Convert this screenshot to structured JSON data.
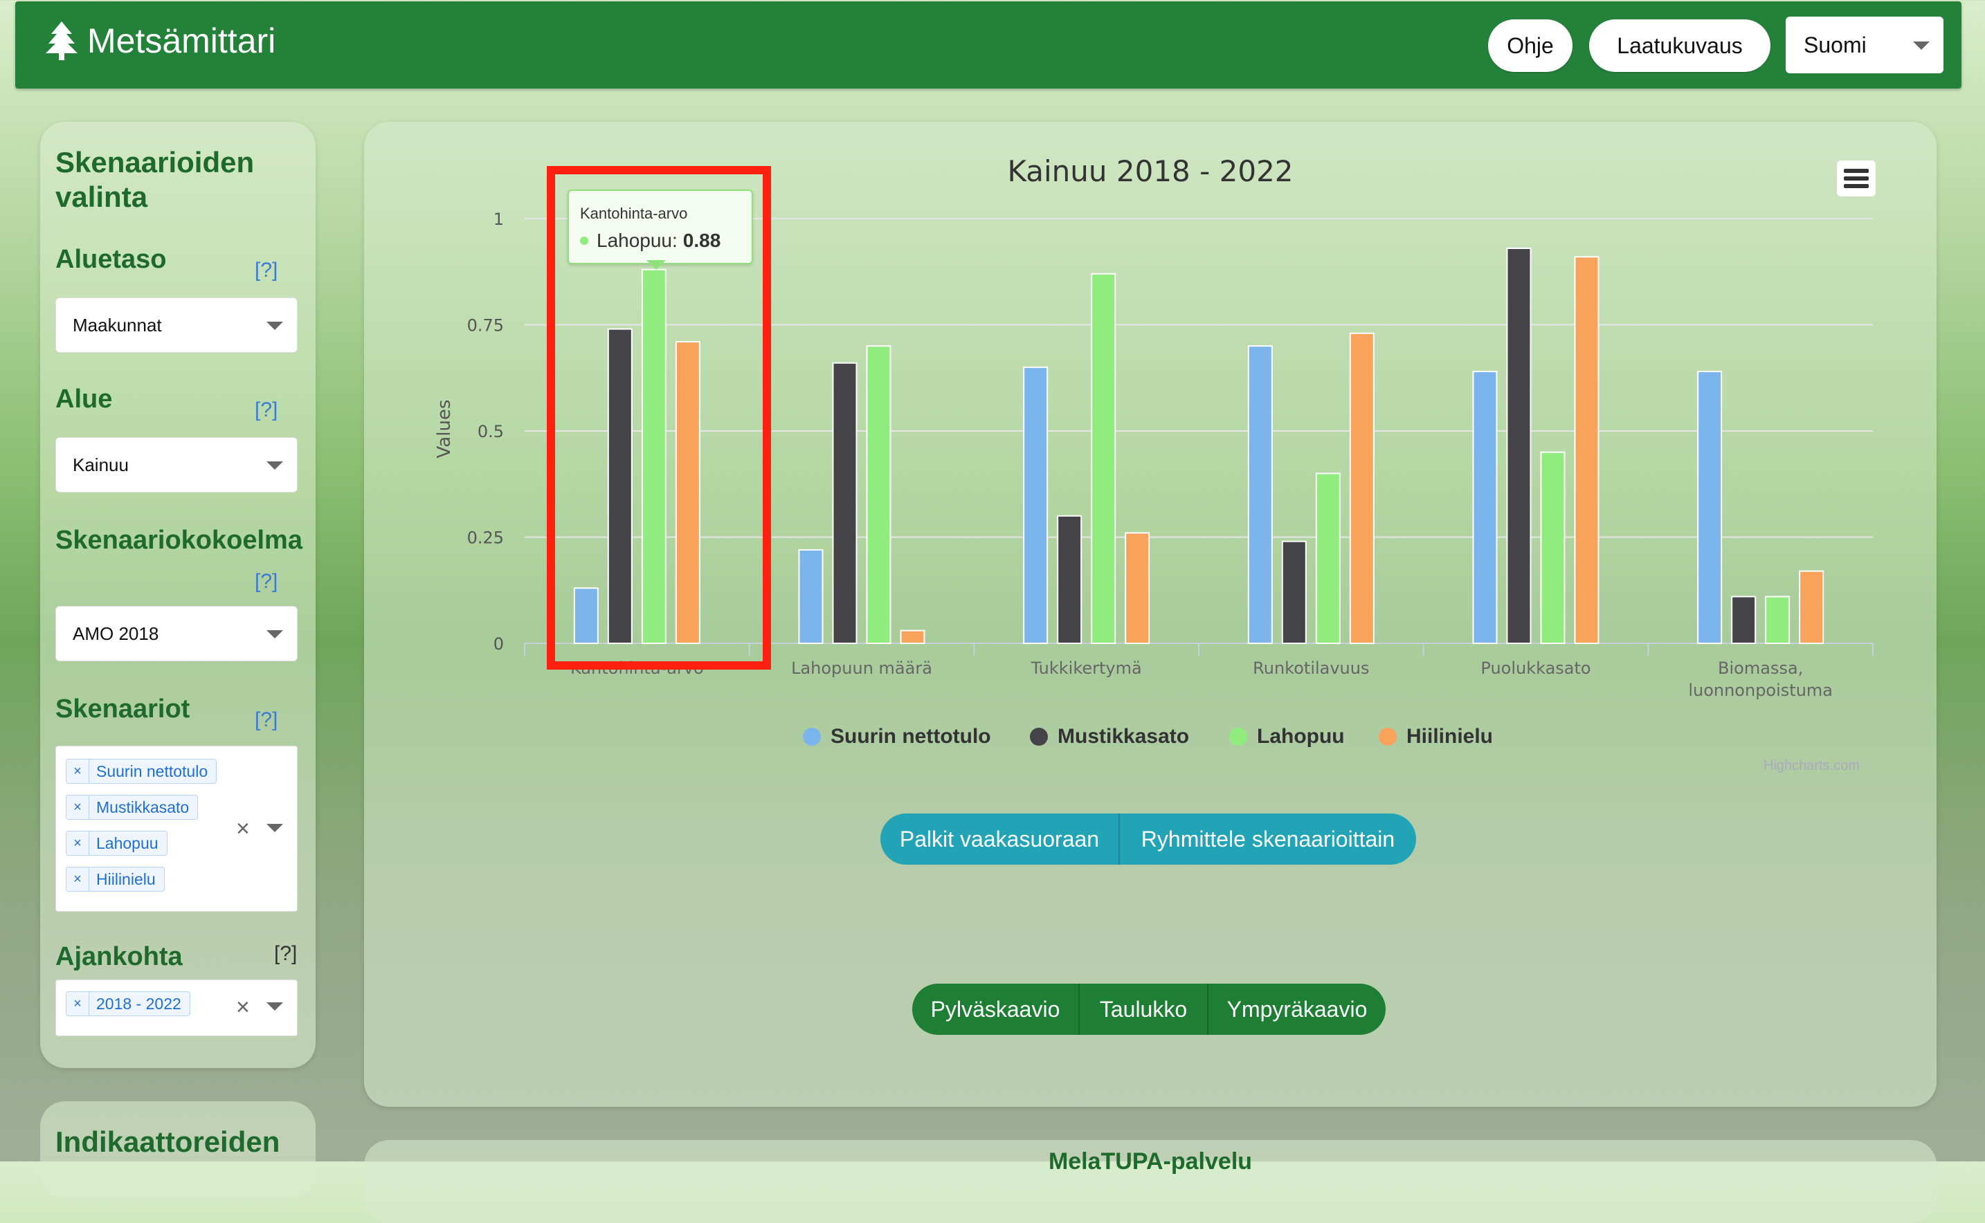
{
  "header": {
    "app_title": "Metsämittari",
    "help_label": "Ohje",
    "quality_label": "Laatukuvaus",
    "language_selected": "Suomi"
  },
  "sidebar": {
    "section_title_line1": "Skenaarioiden",
    "section_title_line2": "valinta",
    "aluetaso": {
      "label": "Aluetaso",
      "help": "[?]",
      "value": "Maakunnat"
    },
    "alue": {
      "label": "Alue",
      "help": "[?]",
      "value": "Kainuu"
    },
    "skenaariokokoelma": {
      "label": "Skenaariokokoelma",
      "help": "[?]",
      "value": "AMO 2018"
    },
    "skenaariot": {
      "label": "Skenaariot",
      "help": "[?]",
      "tags": [
        "Suurin nettotulo",
        "Mustikkasato",
        "Lahopuu",
        "Hiilinielu"
      ]
    },
    "ajankohta": {
      "label": "Ajankohta",
      "help": "[?]",
      "tags": [
        "2018 - 2022"
      ]
    },
    "next_section_title": "Indikaattoreiden"
  },
  "main": {
    "orientation_buttons": [
      "Palkit vaakasuoraan",
      "Ryhmittele skenaarioittain"
    ],
    "view_buttons": [
      "Pylväskaavio",
      "Taulukko",
      "Ympyräkaavio"
    ],
    "credits": "Highcharts.com",
    "next_panel_title": "MelaTUPA-palvelu"
  },
  "tooltip": {
    "title": "Kantohinta-arvo",
    "series": "Lahopuu:",
    "value": "0.88"
  },
  "colors": {
    "header_green": "#24813a",
    "highlight_red": "#ff2010"
  },
  "chart_data": {
    "type": "bar",
    "title": "Kainuu 2018 - 2022",
    "ylabel": "Values",
    "ylim": [
      0,
      1
    ],
    "yticks": [
      "0",
      "0.25",
      "0.5",
      "0.75",
      "1"
    ],
    "categories": [
      "Kantohinta-arvo",
      "Lahopuun määrä",
      "Tukkikertymä",
      "Runkotilavuus",
      "Puolukkasato",
      "Biomassa, luonnonpoistuma"
    ],
    "series": [
      {
        "name": "Suurin nettotulo",
        "color": "#7cb5ec",
        "values": [
          0.13,
          0.22,
          0.65,
          0.7,
          0.64,
          0.64
        ]
      },
      {
        "name": "Mustikkasato",
        "color": "#434348",
        "values": [
          0.74,
          0.66,
          0.3,
          0.24,
          0.93,
          0.11
        ]
      },
      {
        "name": "Lahopuu",
        "color": "#90ed7d",
        "values": [
          0.88,
          0.7,
          0.87,
          0.4,
          0.45,
          0.11
        ]
      },
      {
        "name": "Hiilinielu",
        "color": "#f7a35c",
        "values": [
          0.71,
          0.03,
          0.26,
          0.73,
          0.91,
          0.17
        ]
      }
    ]
  }
}
